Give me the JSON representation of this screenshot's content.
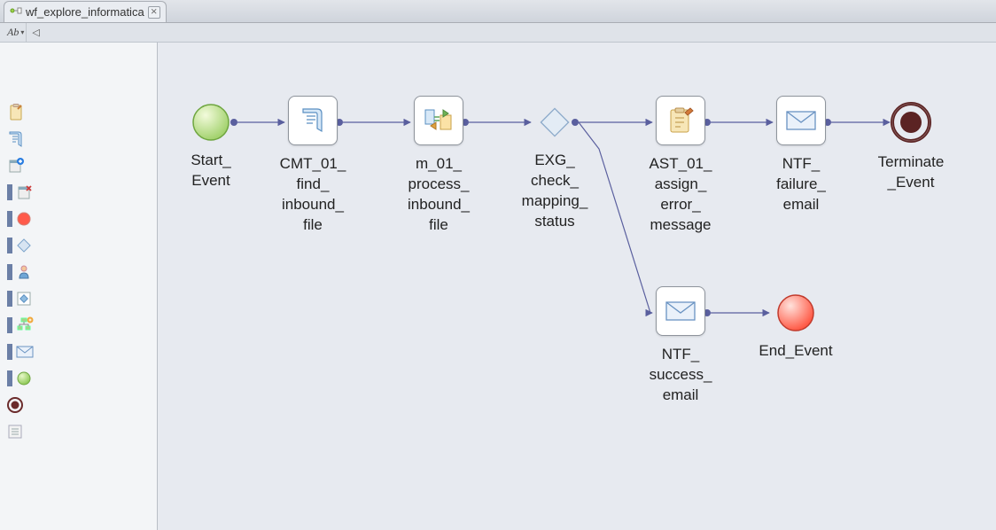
{
  "tab": {
    "title": "wf_explore_informatica",
    "close_glyph": "⨯"
  },
  "mini_toolbar": {
    "ab_label": "Ab",
    "back_glyph": "◁"
  },
  "palette": {
    "items": [
      {
        "name": "assignment-icon"
      },
      {
        "name": "command-icon"
      },
      {
        "name": "db-plus-icon"
      },
      {
        "name": "db-x-icon"
      },
      {
        "name": "red-dot-icon"
      },
      {
        "name": "diamond-icon"
      },
      {
        "name": "human-icon"
      },
      {
        "name": "boxed-diamond-icon"
      },
      {
        "name": "tree-plus-icon"
      },
      {
        "name": "mail-icon"
      },
      {
        "name": "green-dot-icon"
      },
      {
        "name": "terminate-dot-icon"
      },
      {
        "name": "list-icon"
      }
    ]
  },
  "nodes": {
    "start": {
      "label": "Start_\nEvent"
    },
    "cmt": {
      "label": "CMT_01_\nfind_\ninbound_\nfile"
    },
    "map": {
      "label": "m_01_\nprocess_\ninbound_\nfile"
    },
    "exg": {
      "label": "EXG_\ncheck_\nmapping_\nstatus"
    },
    "ast": {
      "label": "AST_01_\nassign_\nerror_\nmessage"
    },
    "ntf_fail": {
      "label": "NTF_\nfailure_\nemail"
    },
    "terminate": {
      "label": "Terminate\n_Event"
    },
    "ntf_succ": {
      "label": "NTF_\nsuccess_\nemail"
    },
    "end": {
      "label": "End_Event"
    }
  },
  "chart_data": {
    "type": "flow-diagram",
    "nodes": [
      {
        "id": "start",
        "type": "start-event",
        "label": "Start_Event"
      },
      {
        "id": "cmt",
        "type": "command-task",
        "label": "CMT_01_find_inbound_file"
      },
      {
        "id": "map",
        "type": "mapping-task",
        "label": "m_01_process_inbound_file"
      },
      {
        "id": "exg",
        "type": "exclusive-gateway",
        "label": "EXG_check_mapping_status"
      },
      {
        "id": "ast",
        "type": "assignment-task",
        "label": "AST_01_assign_error_message"
      },
      {
        "id": "ntf_fail",
        "type": "notification-task",
        "label": "NTF_failure_email"
      },
      {
        "id": "terminate",
        "type": "terminate-event",
        "label": "Terminate_Event"
      },
      {
        "id": "ntf_succ",
        "type": "notification-task",
        "label": "NTF_success_email"
      },
      {
        "id": "end",
        "type": "end-event",
        "label": "End_Event"
      }
    ],
    "edges": [
      {
        "from": "start",
        "to": "cmt"
      },
      {
        "from": "cmt",
        "to": "map"
      },
      {
        "from": "map",
        "to": "exg"
      },
      {
        "from": "exg",
        "to": "ast"
      },
      {
        "from": "ast",
        "to": "ntf_fail"
      },
      {
        "from": "ntf_fail",
        "to": "terminate"
      },
      {
        "from": "exg",
        "to": "ntf_succ"
      },
      {
        "from": "ntf_succ",
        "to": "end"
      }
    ]
  }
}
